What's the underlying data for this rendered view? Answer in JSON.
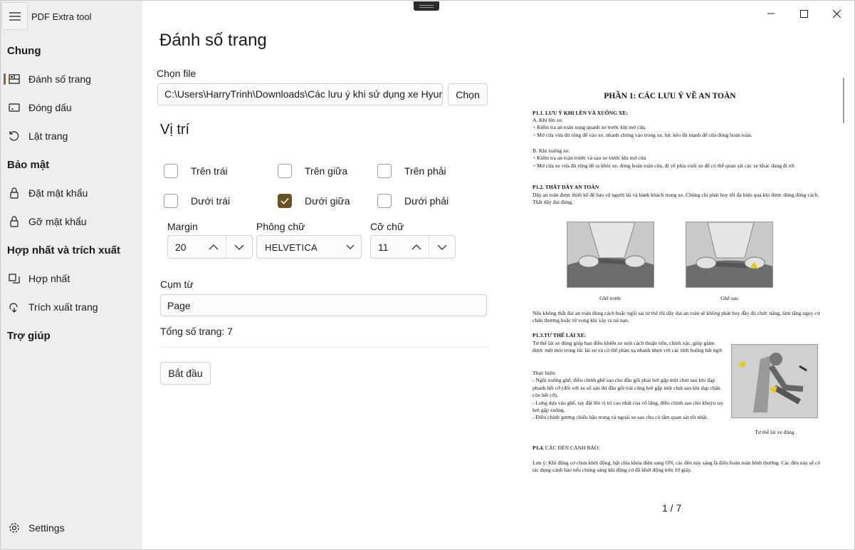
{
  "app": {
    "title": "PDF Extra tool"
  },
  "sidebar": {
    "sections": [
      {
        "label": "Chung"
      },
      {
        "label": "Bảo mật"
      },
      {
        "label": "Hợp nhất và trích xuất"
      },
      {
        "label": "Trợ giúp"
      }
    ],
    "items": [
      {
        "label": "Đánh số trang",
        "icon": "page-number-icon",
        "active": true
      },
      {
        "label": "Đóng dấu",
        "icon": "stamp-icon"
      },
      {
        "label": "Lật trang",
        "icon": "rotate-icon"
      },
      {
        "label": "Đặt mật khẩu",
        "icon": "lock-icon"
      },
      {
        "label": "Gỡ mật khẩu",
        "icon": "lock-icon"
      },
      {
        "label": "Hợp nhất",
        "icon": "merge-icon"
      },
      {
        "label": "Trích xuất trang",
        "icon": "extract-icon"
      }
    ],
    "settings_label": "Settings"
  },
  "main": {
    "title": "Đánh số trang",
    "file_label": "Chọn file",
    "file_path": "C:\\Users\\HarryTrinh\\Downloads\\Các lưu ý khi sử dụng xe Hyundai.pdf",
    "choose_button": "Chọn",
    "position_heading": "Vị trí",
    "positions": [
      {
        "label": "Trên trái",
        "checked": false
      },
      {
        "label": "Trên giữa",
        "checked": false
      },
      {
        "label": "Trên phải",
        "checked": false
      },
      {
        "label": "Dưới trái",
        "checked": false
      },
      {
        "label": "Dưới giữa",
        "checked": true
      },
      {
        "label": "Dưới phải",
        "checked": false
      }
    ],
    "margin_label": "Margin",
    "margin_value": "20",
    "font_label": "Phông chữ",
    "font_value": "HELVETICA",
    "size_label": "Cỡ chữ",
    "size_value": "11",
    "phrase_label": "Cụm từ",
    "phrase_value": "Page",
    "total_pages": "Tổng số trang: 7",
    "start_button": "Bắt đầu"
  },
  "preview": {
    "page_indicator": "1 / 7",
    "doc": {
      "title": "PHẦN 1: CÁC LƯU Ý VỀ AN TOÀN",
      "s1_head": "P1.1. LƯU Ý KHI LÊN VÀ XUỐNG XE:",
      "s1_body": "A. Khi lên xe:\n+ Kiểm tra an toàn xung quanh xe trước khi mở cửa.\n+ Mở cửa vừa đủ rộng để vào xe, nhanh chóng vào trong xe, lực kéo đủ mạnh để cửa đóng hoàn toàn.",
      "s1_body2": "B. Khi xuống xe:\n+ Kiểm tra an toàn trước và sau xe trước khi mở cửa\n+ Mở cửa xe vừa đủ rộng để ra khỏi xe, đóng hoàn toàn cửa, đi về phía cuối xe để có thể quan sát các xe khác đang đi tới",
      "s2_head": "P1.2. THẮT DÂY AN TOÀN",
      "s2_body": "Dây an toàn được thiết kế để bảo vệ người lái và hành khách trong xe. Chúng chỉ phát huy tối đa hiệu quả khi được dùng đúng cách.\nThắt dây đai đúng.",
      "caption_front": "Ghế trước",
      "caption_rear": "Ghế sau",
      "s2_note": "Nếu không thắt đai an toàn đúng cách hoặc ngồi sai tư thế thì dây đai an toàn sẽ không phát huy đầy đủ chức năng, làm tăng nguy cơ chấn thương hoặc tử vong khi xảy ra tai nạn.",
      "s3_head": "P1.3.TƯ THẾ LÁI XE:",
      "s3_body": "Tư thế lái xe đúng giúp bạn điều khiển xe một cách thuận tiện, chính xác, giúp giảm được mệt mỏi trong lúc lái xe và có thể phản xạ nhanh nhẹn với các tình huống bất ngờ.",
      "s3_steps": "Thực hiện:\n- Ngồi xuống ghế, điều chỉnh ghế sao cho đầu gối phải hơi gập một chút sau khi đạp phanh hết cỡ (đối với xe số sàn thì đầu gối trái cũng hơi gập một chút sau khi đạp chân côn hết cỡ).\n- Lưng dựa vào ghế, tay đặt lên vị trí cao nhất của vô lăng, điều chỉnh sao cho khuỷu tay hơi gập xuống.\n- Điều chỉnh gương chiếu hậu trong và ngoài xe sao cho có tầm quan sát tốt nhất.",
      "caption_posture": "Tư thế lái xe đúng",
      "s4_head": "P1.4.",
      "s4_head_rest": " CÁC ĐÈN CẢNH BÁO:",
      "s4_body": "Lưu ý: Khi động cơ chưa khởi động, bật chìa khóa điện sang ON, các đèn này sáng là điều hoàn toàn bình thường. Các đèn này sẽ có tác dụng cảnh báo nếu chúng sáng khi động cơ đã khởi động trên 10 giây."
    }
  },
  "colors": {
    "accent": "#6b5321",
    "sidebar_bg": "#eeeeee"
  }
}
